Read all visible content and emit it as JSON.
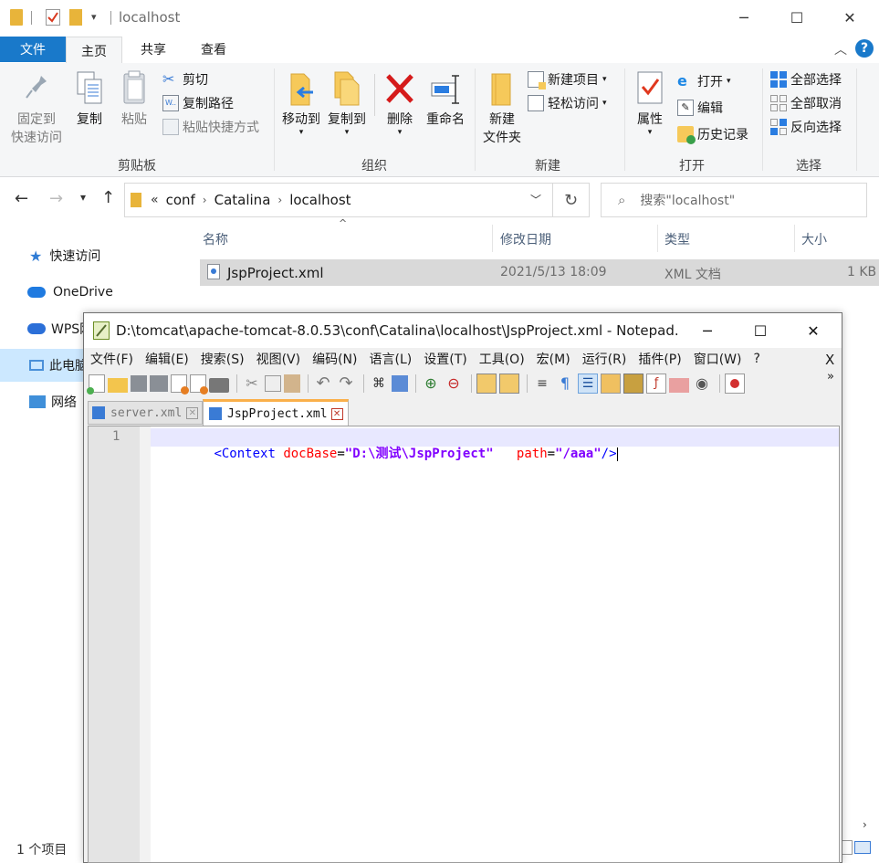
{
  "explorer": {
    "title": "localhost",
    "ribbon_tabs": [
      "文件",
      "主页",
      "共享",
      "查看"
    ],
    "clipboard": {
      "pin_line1": "固定到",
      "pin_line2": "快速访问",
      "copy": "复制",
      "paste": "粘贴",
      "cut": "剪切",
      "copy_path": "复制路径",
      "paste_shortcut": "粘贴快捷方式",
      "group": "剪贴板"
    },
    "organize": {
      "move_to": "移动到",
      "copy_to": "复制到",
      "delete": "删除",
      "rename": "重命名",
      "group": "组织"
    },
    "new": {
      "new_folder_line1": "新建",
      "new_folder_line2": "文件夹",
      "new_item": "新建项目",
      "easy_access": "轻松访问",
      "group": "新建"
    },
    "open": {
      "properties": "属性",
      "open": "打开",
      "edit": "编辑",
      "history": "历史记录",
      "group": "打开"
    },
    "select": {
      "select_all": "全部选择",
      "select_none": "全部取消",
      "invert": "反向选择",
      "group": "选择"
    },
    "breadcrumb": {
      "overflow": "«",
      "items": [
        "conf",
        "Catalina",
        "localhost"
      ]
    },
    "search_placeholder": "搜索\"localhost\"",
    "sidebar": [
      "快速访问",
      "OneDrive",
      "WPS网盘",
      "此电脑",
      "网络"
    ],
    "columns": [
      "名称",
      "修改日期",
      "类型",
      "大小"
    ],
    "files": [
      {
        "name": "JspProject.xml",
        "date": "2021/5/13 18:09",
        "type": "XML 文档",
        "size": "1 KB"
      }
    ],
    "status": "1 个项目"
  },
  "notepad": {
    "title": "D:\\tomcat\\apache-tomcat-8.0.53\\conf\\Catalina\\localhost\\JspProject.xml - Notepad...",
    "menu": [
      "文件(F)",
      "编辑(E)",
      "搜索(S)",
      "视图(V)",
      "编码(N)",
      "语言(L)",
      "设置(T)",
      "工具(O)",
      "宏(M)",
      "运行(R)",
      "插件(P)",
      "窗口(W)",
      "?"
    ],
    "close_doc": "X",
    "tabs": [
      "server.xml",
      "JspProject.xml"
    ],
    "line_number": "1",
    "code": {
      "open": "<Context",
      "attr1": "docBase",
      "eq1": "=",
      "val1": "\"D:\\测试\\JspProject\"",
      "attr2": "path",
      "eq2": "=",
      "val2": "\"/aaa\"",
      "close": "/>"
    }
  },
  "colors": {
    "accent": "#1979ca",
    "selected_row": "#d9d9d9",
    "xml_tag": "#0000ff",
    "xml_attr": "#ff0000",
    "xml_value": "#8000ff"
  }
}
